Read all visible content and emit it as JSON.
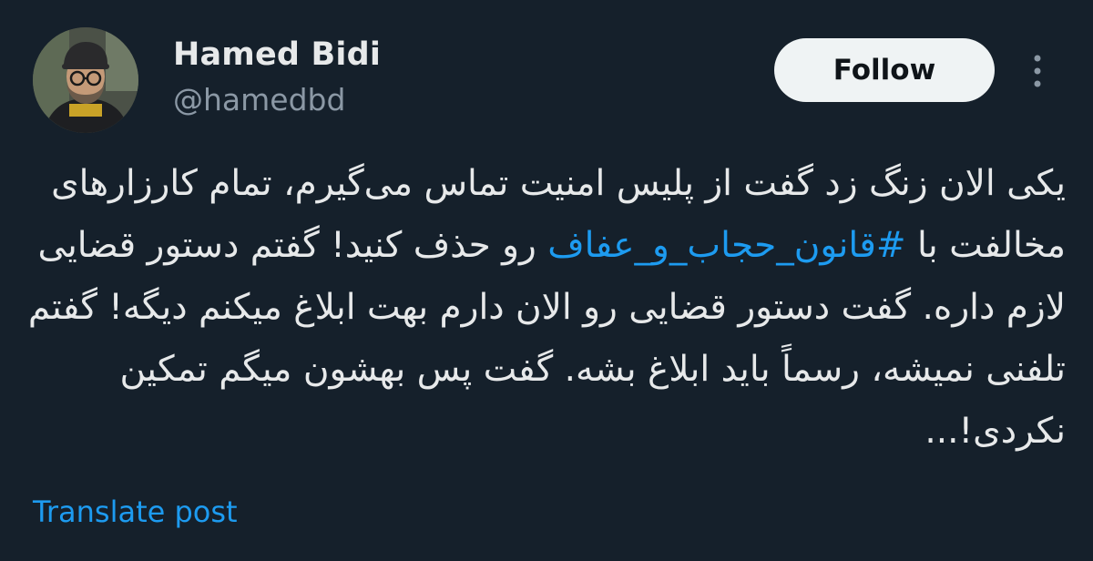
{
  "author": {
    "display_name": "Hamed Bidi",
    "handle": "@hamedbd",
    "avatar_icon": "user-avatar-photo"
  },
  "actions": {
    "follow_label": "Follow",
    "more_icon": "more-vertical-icon"
  },
  "tweet": {
    "text_before_hashtag": "یکی الان زنگ زد گفت از پلیس امنیت تماس می‌گیرم، تمام کارزارهای مخالفت با ",
    "hashtag": "#قانون_حجاب_و_عفاف",
    "text_after_hashtag": " رو حذف کنید! گفتم دستور قضایی لازم داره. گفت دستور قضایی رو الان دارم بهت ابلاغ میکنم دیگه! گفتم تلفنی نمیشه، رسماً باید ابلاغ بشه. گفت پس بهشون میگم تمکین نکردی!..."
  },
  "footer": {
    "translate_label": "Translate post"
  },
  "colors": {
    "background": "#15202b",
    "text": "#e7e9ea",
    "secondary_text": "#8b98a5",
    "link": "#1d9bf0",
    "button_bg": "#eff3f4",
    "button_text": "#0f1419"
  }
}
